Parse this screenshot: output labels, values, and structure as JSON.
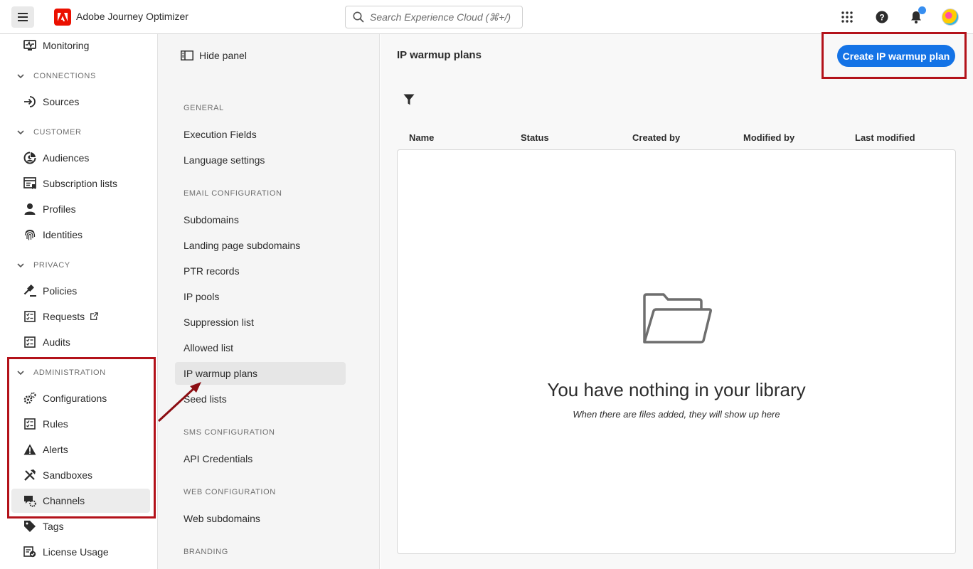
{
  "topbar": {
    "app_title": "Adobe Journey Optimizer",
    "search_placeholder": "Search Experience Cloud (⌘+/)"
  },
  "leftnav": {
    "monitoring": "Monitoring",
    "connections_header": "CONNECTIONS",
    "sources": "Sources",
    "customer_header": "CUSTOMER",
    "audiences": "Audiences",
    "subscription_lists": "Subscription lists",
    "profiles": "Profiles",
    "identities": "Identities",
    "privacy_header": "PRIVACY",
    "policies": "Policies",
    "requests": "Requests",
    "audits": "Audits",
    "administration_header": "ADMINISTRATION",
    "configurations": "Configurations",
    "rules": "Rules",
    "alerts": "Alerts",
    "sandboxes": "Sandboxes",
    "channels": "Channels",
    "tags": "Tags",
    "license_usage": "License Usage"
  },
  "subpanel": {
    "hide_panel": "Hide panel",
    "general_header": "GENERAL",
    "execution_fields": "Execution Fields",
    "language_settings": "Language settings",
    "email_header": "EMAIL CONFIGURATION",
    "subdomains": "Subdomains",
    "landing_page_subdomains": "Landing page subdomains",
    "ptr_records": "PTR records",
    "ip_pools": "IP pools",
    "suppression_list": "Suppression list",
    "allowed_list": "Allowed list",
    "ip_warmup_plans": "IP warmup plans",
    "seed_lists": "Seed lists",
    "sms_header": "SMS CONFIGURATION",
    "api_credentials": "API Credentials",
    "web_header": "WEB CONFIGURATION",
    "web_subdomains": "Web subdomains",
    "branding_header": "BRANDING"
  },
  "main": {
    "title": "IP warmup plans",
    "create_button": "Create IP warmup plan",
    "columns": [
      "Name",
      "Status",
      "Created by",
      "Modified by",
      "Last modified"
    ],
    "empty_title": "You have nothing in your library",
    "empty_subtitle": "When there are files added, they will show up here"
  },
  "colors": {
    "accent": "#1473e6",
    "annotation": "#b3121a",
    "adobe_red": "#eb1000"
  }
}
